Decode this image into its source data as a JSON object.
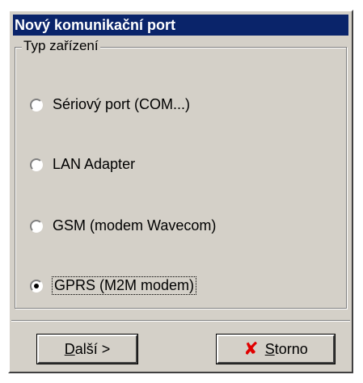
{
  "window": {
    "title": "Nový komunikační port"
  },
  "group": {
    "label": "Typ zařízení",
    "options": [
      {
        "label": "Sériový port (COM...)",
        "selected": false
      },
      {
        "label": "LAN Adapter",
        "selected": false
      },
      {
        "label": "GSM (modem Wavecom)",
        "selected": false
      },
      {
        "label": "GPRS (M2M modem)",
        "selected": true
      }
    ]
  },
  "buttons": {
    "next": {
      "accel": "D",
      "rest": "alší >"
    },
    "cancel": {
      "accel": "S",
      "rest": "torno",
      "icon": "red-x-icon"
    }
  },
  "colors": {
    "titlebar": "#0a246a",
    "face": "#d4d0c8",
    "cancel_icon": "#e00000"
  }
}
